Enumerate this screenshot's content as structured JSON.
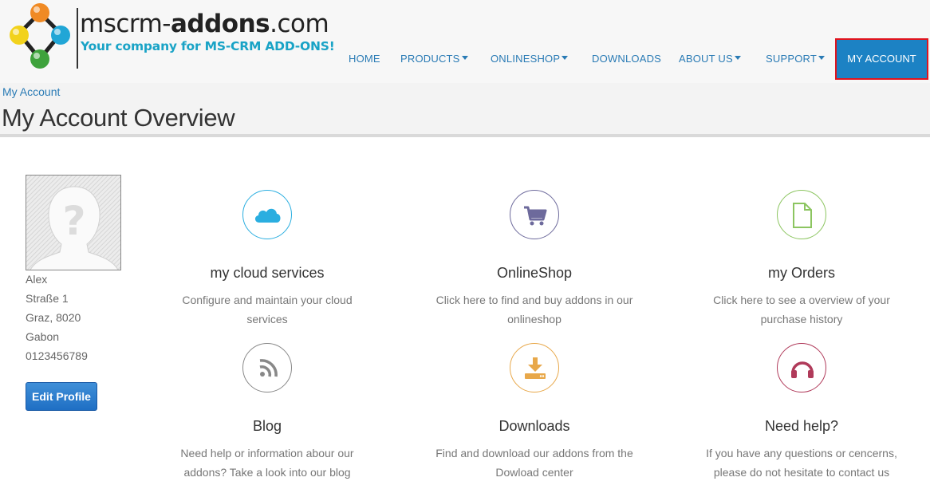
{
  "brand": {
    "name_light": "mscrm-",
    "name_bold": "addons",
    "name_suffix": ".com",
    "tagline": "Your company for MS-CRM ADD-ONS!"
  },
  "nav": {
    "home": "HOME",
    "products": "PRODUCTS",
    "onlineshop": "ONLINESHOP",
    "downloads": "DOWNLOADS",
    "about": "ABOUT US",
    "support": "SUPPORT",
    "account": "MY ACCOUNT"
  },
  "breadcrumb": "My Account",
  "page_title": "My Account Overview",
  "profile": {
    "name": "Alex",
    "street": "Straße 1",
    "city": "Graz, 8020",
    "country": "Gabon",
    "phone": "0123456789",
    "edit_label": "Edit Profile"
  },
  "tiles": [
    {
      "title": "my cloud services",
      "desc": "Configure and maintain your cloud services",
      "icon": "cloud-icon",
      "color": "#2aaee0"
    },
    {
      "title": "OnlineShop",
      "desc": "Click here to find and buy addons in our onlineshop",
      "icon": "cart-icon",
      "color": "#6d6a9c"
    },
    {
      "title": "my Orders",
      "desc": "Click here to see a overview of your purchase history",
      "icon": "document-icon",
      "color": "#8cc560"
    },
    {
      "title": "Blog",
      "desc": "Need help or information abour our addons? Take a look into our blog",
      "icon": "rss-icon",
      "color": "#888888"
    },
    {
      "title": "Downloads",
      "desc": "Find and download our addons from the Dowload center",
      "icon": "download-icon",
      "color": "#e8a84a"
    },
    {
      "title": "Need help?",
      "desc": "If you have any questions or cencerns, please do not hesitate to contact us",
      "icon": "headset-icon",
      "color": "#b03a5a"
    }
  ]
}
